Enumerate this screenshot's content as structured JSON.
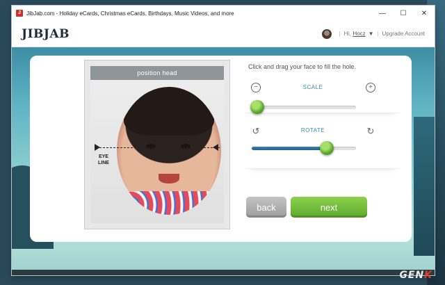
{
  "window": {
    "title": "JibJab.com - Holiday eCards, Christmas eCards, Birthdays, Music Videos, and more",
    "icon_text": "J",
    "minimize": "—",
    "maximize": "☐",
    "close": "✕"
  },
  "header": {
    "logo": "JIBJAB",
    "greeting": "Hi,",
    "username": "Hocz",
    "upgrade": "Upgrade Account"
  },
  "editor": {
    "position_head_label": "position head",
    "eye_line_label_1": "EYE",
    "eye_line_label_2": "LINE",
    "instruction": "Click and drag your face to fill the hole.",
    "scale": {
      "label": "SCALE",
      "value": 0.05
    },
    "rotate": {
      "label": "ROTATE",
      "value": 0.72
    },
    "back_label": "back",
    "next_label": "next"
  },
  "watermark": {
    "text_main": "GEN",
    "text_accent": "K"
  },
  "colors": {
    "accent_blue": "#3a8bb0",
    "next_green": "#5aa92a",
    "back_grey": "#9c9c9c"
  },
  "icons": [
    "zoom-out-icon",
    "zoom-in-icon",
    "rotate-left-icon",
    "rotate-right-icon",
    "caret-down-icon"
  ]
}
